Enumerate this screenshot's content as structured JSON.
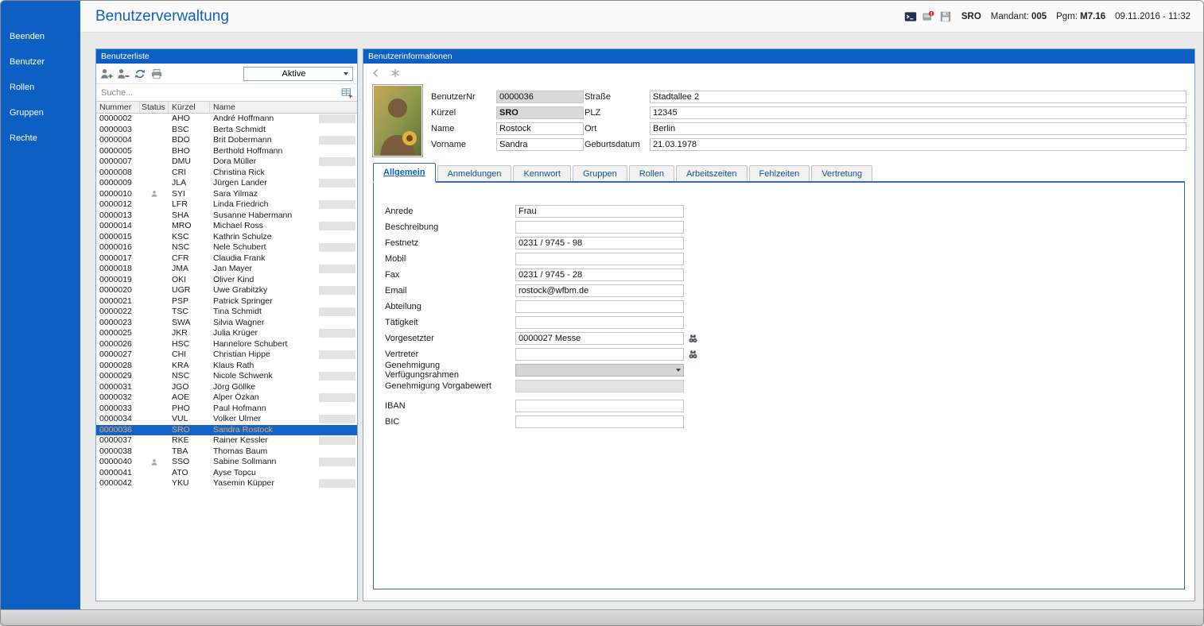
{
  "window": {
    "title": "Benutzerverwaltung",
    "header_icons": [
      "terminal",
      "alert",
      "save"
    ],
    "status": {
      "user": "SRO",
      "mandant_label": "Mandant:",
      "mandant_value": "005",
      "pgm_label": "Pgm:",
      "pgm_value": "M7.16",
      "datetime": "09.11.2016 - 11:32"
    }
  },
  "sidebar": {
    "items": [
      "Beenden",
      "Benutzer",
      "Rollen",
      "Gruppen",
      "Rechte"
    ]
  },
  "userlist": {
    "title": "Benutzerliste",
    "toolbar_icons": [
      "add-user",
      "remove-user",
      "refresh",
      "print"
    ],
    "filter_value": "Aktive",
    "search_placeholder": "Suche...",
    "search_icon": "table-search",
    "columns": [
      "Nummer",
      "Status",
      "Kürzel",
      "Name"
    ],
    "selected": "0000036",
    "rows": [
      [
        "0000002",
        "",
        "AHO",
        "André Hoffmann"
      ],
      [
        "0000003",
        "",
        "BSC",
        "Berta Schmidt"
      ],
      [
        "0000004",
        "",
        "BDO",
        "Brit Dobermann"
      ],
      [
        "0000005",
        "",
        "BHO",
        "Berthold Hoffmann"
      ],
      [
        "0000007",
        "",
        "DMU",
        "Dora Müller"
      ],
      [
        "0000008",
        "",
        "CRI",
        "Christina Rick"
      ],
      [
        "0000009",
        "",
        "JLA",
        "Jürgen Lander"
      ],
      [
        "0000010",
        "person",
        "SYI",
        "Sara Yilmaz"
      ],
      [
        "0000012",
        "",
        "LFR",
        "Linda Friedrich"
      ],
      [
        "0000013",
        "",
        "SHA",
        "Susanne Habermann"
      ],
      [
        "0000014",
        "",
        "MRO",
        "Michael Ross"
      ],
      [
        "0000015",
        "",
        "KSC",
        "Kathrin Schulze"
      ],
      [
        "0000016",
        "",
        "NSC",
        "Nele Schubert"
      ],
      [
        "0000017",
        "",
        "CFR",
        "Claudia Frank"
      ],
      [
        "0000018",
        "",
        "JMA",
        "Jan Mayer"
      ],
      [
        "0000019",
        "",
        "OKI",
        "Oliver Kind"
      ],
      [
        "0000020",
        "",
        "UGR",
        "Uwe Grabitzky"
      ],
      [
        "0000021",
        "",
        "PSP",
        "Patrick Springer"
      ],
      [
        "0000022",
        "",
        "TSC",
        "Tina Schmidt"
      ],
      [
        "0000023",
        "",
        "SWA",
        "Silvia Wagner"
      ],
      [
        "0000025",
        "",
        "JKR",
        "Julia Krüger"
      ],
      [
        "0000026",
        "",
        "HSC",
        "Hannelore Schubert"
      ],
      [
        "0000027",
        "",
        "CHI",
        "Christian Hippe"
      ],
      [
        "0000028",
        "",
        "KRA",
        "Klaus Rath"
      ],
      [
        "0000029",
        "",
        "NSC",
        "Nicole Schwenk"
      ],
      [
        "0000031",
        "",
        "JGO",
        "Jörg Göllke"
      ],
      [
        "0000032",
        "",
        "AOE",
        "Alper Özkan"
      ],
      [
        "0000033",
        "",
        "PHO",
        "Paul Hofmann"
      ],
      [
        "0000034",
        "",
        "VUL",
        "Volker Ulmer"
      ],
      [
        "0000036",
        "",
        "SRO",
        "Sandra Rostock"
      ],
      [
        "0000037",
        "",
        "RKE",
        "Rainer Kessler"
      ],
      [
        "0000038",
        "",
        "TBA",
        "Thomas Baum"
      ],
      [
        "0000040",
        "person",
        "SSO",
        "Sabine Sollmann"
      ],
      [
        "0000041",
        "",
        "ATO",
        "Ayse Topcu"
      ],
      [
        "0000042",
        "",
        "YKU",
        "Yasemin Küpper"
      ]
    ]
  },
  "userinfo": {
    "title": "Benutzerinformationen",
    "toolbar_icons": [
      "nav-left",
      "asterisk"
    ],
    "identity_left": [
      {
        "label": "BenutzerNr",
        "value": "0000036",
        "readonly": true
      },
      {
        "label": "Kürzel",
        "value": "SRO",
        "readonly": true,
        "bold": true
      },
      {
        "label": "Name",
        "value": "Rostock"
      },
      {
        "label": "Vorname",
        "value": "Sandra"
      }
    ],
    "identity_right": [
      {
        "label": "Straße",
        "value": "Stadtallee 2"
      },
      {
        "label": "PLZ",
        "value": "12345"
      },
      {
        "label": "Ort",
        "value": "Berlin"
      },
      {
        "label": "Geburtsdatum",
        "value": "21.03.1978"
      }
    ],
    "tabs": [
      "Allgemein",
      "Anmeldungen",
      "Kennwort",
      "Gruppen",
      "Rollen",
      "Arbeitszeiten",
      "Fehlzeiten",
      "Vertretung"
    ],
    "active_tab": "Allgemein",
    "form": [
      {
        "label": "Anrede",
        "value": "Frau",
        "type": "text"
      },
      {
        "label": "Beschreibung",
        "value": "",
        "type": "text"
      },
      {
        "label": "Festnetz",
        "value": "0231 / 9745 - 98",
        "type": "text"
      },
      {
        "label": "Mobil",
        "value": "",
        "type": "text"
      },
      {
        "label": "Fax",
        "value": "0231 / 9745 - 28",
        "type": "text"
      },
      {
        "label": "Email",
        "value": "rostock@wfbm.de",
        "type": "text"
      },
      {
        "label": "Abteilung",
        "value": "",
        "type": "text"
      },
      {
        "label": "Tätigkeit",
        "value": "",
        "type": "text"
      },
      {
        "label": "Vorgesetzter",
        "value": "0000027 Messe",
        "type": "lookup"
      },
      {
        "label": "Vertreter",
        "value": "",
        "type": "lookup"
      },
      {
        "label": "Genehmigung Verfügungsrahmen",
        "value": "",
        "type": "select"
      },
      {
        "label": "Genehmigung Vorgabewert",
        "value": "",
        "type": "readonly"
      },
      {
        "label": "IBAN",
        "value": "",
        "type": "text",
        "gap": true
      },
      {
        "label": "BIC",
        "value": "",
        "type": "text"
      }
    ]
  },
  "colors": {
    "accent": "#0d5fc3",
    "selected_row_bg": "#1464c8",
    "selected_row_text": "#f0a55a",
    "alert_badge": "#d42a2a"
  }
}
